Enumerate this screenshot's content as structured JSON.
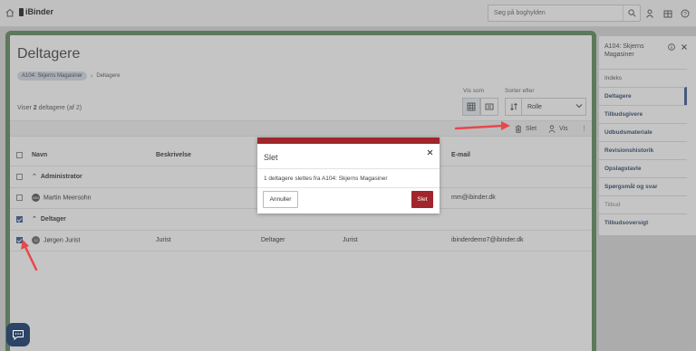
{
  "header": {
    "logo_text": "iBinder",
    "search_placeholder": "Søg på boghylden"
  },
  "main": {
    "title": "Deltagere",
    "breadcrumb": [
      "A104: Skjerns Magasiner",
      "Deltagere"
    ],
    "showing_prefix": "Viser ",
    "showing_count": "2",
    "showing_mid": " deltagere ",
    "showing_total": "(af 2)",
    "view_label": "Vis som",
    "sort_label": "Sorter efter",
    "sort_value": "Rolle",
    "toolbar": {
      "delete_label": "Slet",
      "view_label": "Vis",
      "more_label": "⋮"
    },
    "columns": [
      "Navn",
      "Beskrivelse",
      "",
      "",
      "E-mail"
    ],
    "groups": [
      {
        "name": "Administrator",
        "rows": [
          {
            "initials": "MM",
            "name": "Martin Meersohn",
            "description": "",
            "role": "",
            "extra": "",
            "email": "mm@ibinder.dk",
            "checked": false
          }
        ]
      },
      {
        "name": "Deltager",
        "rows": [
          {
            "initials": "JJ",
            "name": "Jørgen Jurist",
            "description": "Jurist",
            "role": "Deltager",
            "extra": "Jurist",
            "email": "ibinderdemo7@ibinder.dk",
            "checked": true
          }
        ]
      }
    ]
  },
  "side_panel": {
    "title": "A104: Skjerns Magasiner",
    "items": [
      {
        "label": "Indeks",
        "style": "plain"
      },
      {
        "label": "Deltagere",
        "style": "active"
      },
      {
        "label": "Tilbudsgivere",
        "style": "bold"
      },
      {
        "label": "Udbudsmateriale",
        "style": "bold"
      },
      {
        "label": "Revisionshistorik",
        "style": "bold"
      },
      {
        "label": "Opslagstavle",
        "style": "bold"
      },
      {
        "label": "Spørgsmål og svar",
        "style": "bold"
      },
      {
        "label": "Tilbud",
        "style": "muted"
      },
      {
        "label": "Tilbudsoversigt",
        "style": "bold"
      }
    ]
  },
  "dialog": {
    "title": "Slet",
    "message": "1 deltagere slettes fra A104: Skjerns Magasiner",
    "cancel_label": "Annuller",
    "confirm_label": "Slet"
  },
  "colors": {
    "frame_green": "#5f8a5d",
    "danger_red": "#a0262b",
    "annotation_arrow": "#e8474b",
    "nav_blue": "#2e4a6b"
  }
}
